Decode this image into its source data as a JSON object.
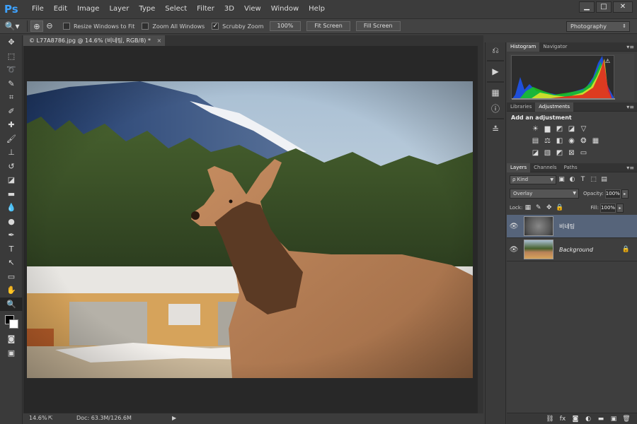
{
  "app": {
    "logo": "Ps"
  },
  "menu": [
    "File",
    "Edit",
    "Image",
    "Layer",
    "Type",
    "Select",
    "Filter",
    "3D",
    "View",
    "Window",
    "Help"
  ],
  "window_controls": {
    "minimize": "▁",
    "maximize": "□",
    "close": "✕"
  },
  "options": {
    "resize_windows": "Resize Windows to Fit",
    "zoom_all": "Zoom All Windows",
    "scrubby_zoom": "Scrubby Zoom",
    "scrubby_checked": "✓",
    "btn_100": "100%",
    "btn_fit": "Fit Screen",
    "btn_fill": "Fill Screen",
    "workspace": "Photography"
  },
  "document": {
    "tab_title": "© L77A8786.jpg @ 14.6% (비네팅, RGB/8) *",
    "tab_close": "×"
  },
  "status": {
    "zoom": "14.6%",
    "doc": "Doc: 63.3M/126.6M"
  },
  "panels": {
    "histogram_tabs": [
      "Histogram",
      "Navigator"
    ],
    "adjust_tabs": [
      "Libraries",
      "Adjustments"
    ],
    "adjust_title": "Add an adjustment",
    "layers_tabs": [
      "Layers",
      "Channels",
      "Paths"
    ],
    "menu_glyph": "▾≡"
  },
  "layers": {
    "kind": "ρ Kind",
    "blend_mode": "Overlay",
    "opacity_label": "Opacity:",
    "opacity": "100%",
    "lock_label": "Lock:",
    "fill_label": "Fill:",
    "fill": "100%",
    "items": [
      {
        "name": "비네팅",
        "selected": true
      },
      {
        "name": "Background",
        "locked": true
      }
    ]
  },
  "colors": {
    "accent": "#3ea2ff",
    "selected_layer": "#56647a",
    "sky": "#c9d7e3",
    "elk": "#b98258"
  }
}
